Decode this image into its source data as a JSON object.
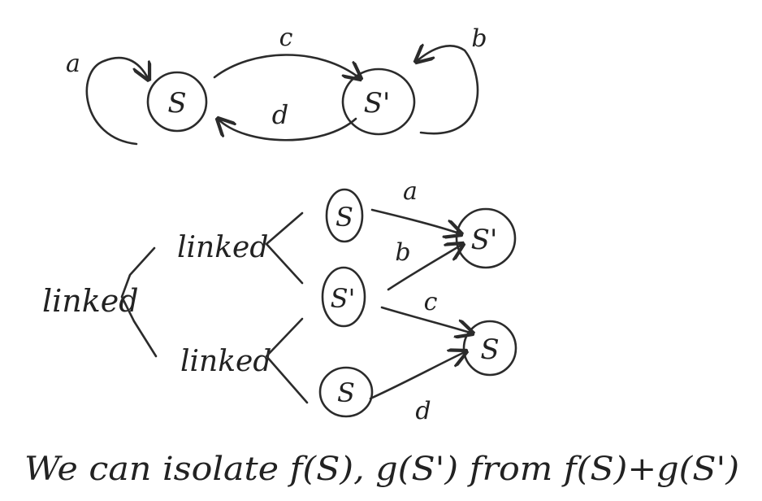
{
  "top_graph": {
    "nodes": {
      "s": "S",
      "s_prime": "S'"
    },
    "edges": {
      "self_s": "a",
      "self_s_prime": "b",
      "forward": "c",
      "backward": "d"
    }
  },
  "tree": {
    "root": "linked",
    "branch_upper": "linked",
    "branch_lower": "linked",
    "upper_leaves": [
      "S",
      "S'"
    ],
    "lower_leaves": [
      "S'",
      "S"
    ],
    "targets": [
      "S'",
      "S"
    ],
    "edges": {
      "a": "a",
      "b": "b",
      "c": "c",
      "d": "d"
    }
  },
  "caption": "We can isolate f(S), g(S') from f(S)+g(S')"
}
